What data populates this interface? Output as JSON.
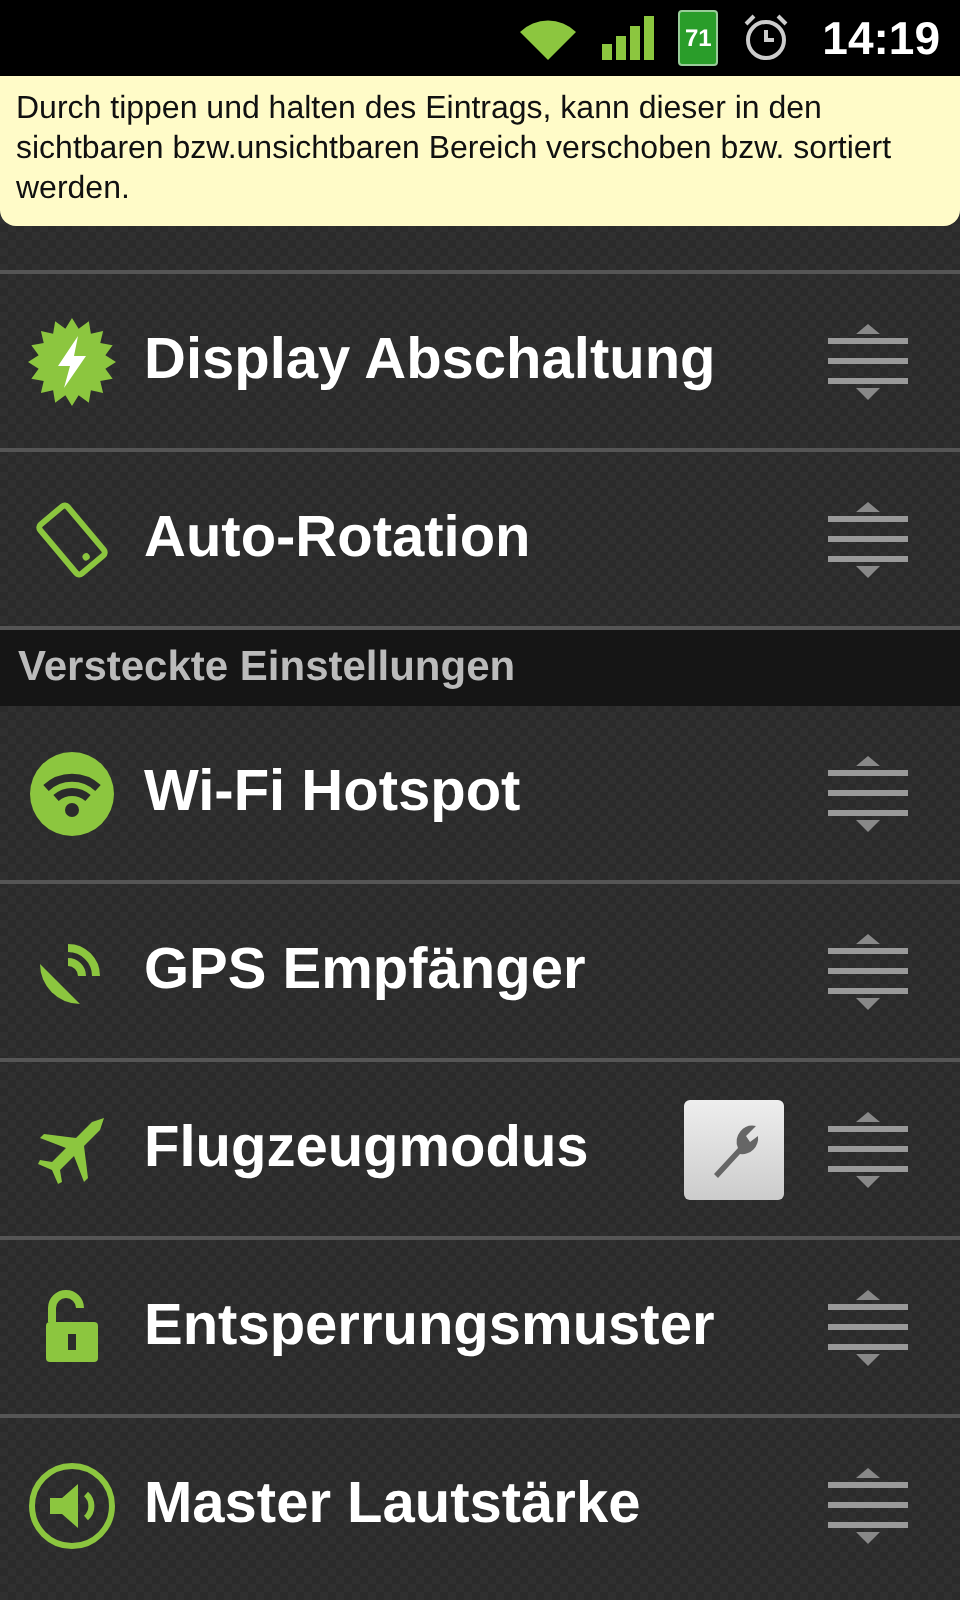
{
  "status_bar": {
    "battery": "71",
    "time": "14:19"
  },
  "hint": "Durch tippen und halten des Eintrags, kann dieser in den sichtbaren bzw.unsichtbaren Bereich verschoben bzw. sortiert werden.",
  "visible_items": [
    {
      "label": "Display Abschaltung",
      "kind": "display",
      "has_settings": false
    },
    {
      "label": "Auto-Rotation",
      "kind": "rotation",
      "has_settings": false
    }
  ],
  "hidden_header": "Versteckte Einstellungen",
  "hidden_items": [
    {
      "label": "Wi-Fi Hotspot",
      "kind": "hotspot",
      "has_settings": false
    },
    {
      "label": "GPS Empfänger",
      "kind": "gps",
      "has_settings": false
    },
    {
      "label": "Flugzeugmodus",
      "kind": "airplane",
      "has_settings": true
    },
    {
      "label": "Entsperrungsmuster",
      "kind": "unlock",
      "has_settings": false
    },
    {
      "label": "Master Lautstärke",
      "kind": "volume",
      "has_settings": false
    }
  ]
}
